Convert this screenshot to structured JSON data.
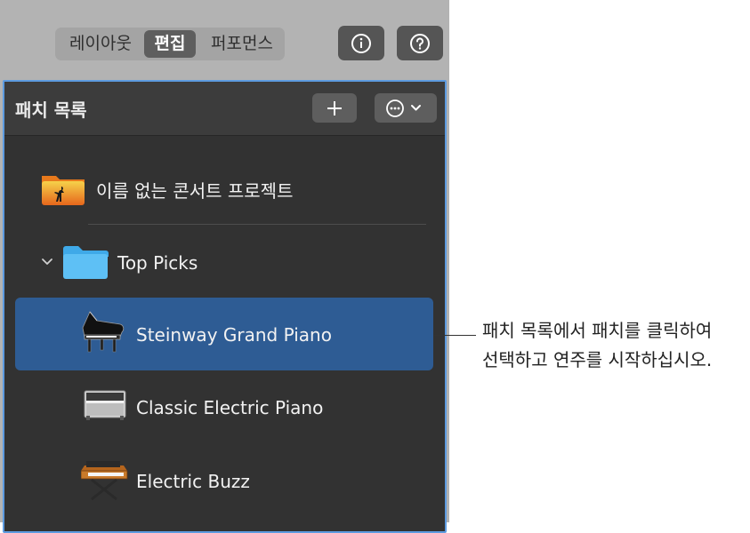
{
  "view_tabs": {
    "layout": "레이아웃",
    "edit": "편집",
    "performance": "퍼포먼스"
  },
  "toolbar": {
    "info_icon": "info-icon",
    "help_icon": "question-icon"
  },
  "patch_list": {
    "title": "패치 목록",
    "add_label": "+",
    "project": {
      "name": "이름 없는 콘서트 프로젝트",
      "icon": "concert-folder-icon"
    },
    "folder": {
      "name": "Top Picks",
      "icon": "folder-icon",
      "expanded": true
    },
    "patches": [
      {
        "name": "Steinway Grand Piano",
        "icon": "grand-piano-icon",
        "selected": true
      },
      {
        "name": "Classic Electric Piano",
        "icon": "electric-piano-icon",
        "selected": false
      },
      {
        "name": "Electric Buzz",
        "icon": "synth-icon",
        "selected": false
      }
    ]
  },
  "callout": {
    "line1": "패치 목록에서 패치를 클릭하여",
    "line2": "선택하고 연주를 시작하십시오."
  },
  "colors": {
    "selection": "#2e5c94",
    "panel_border": "#5d9be0",
    "folder_blue": "#5ec0f5",
    "project_folder_orange": "#f08a24"
  }
}
